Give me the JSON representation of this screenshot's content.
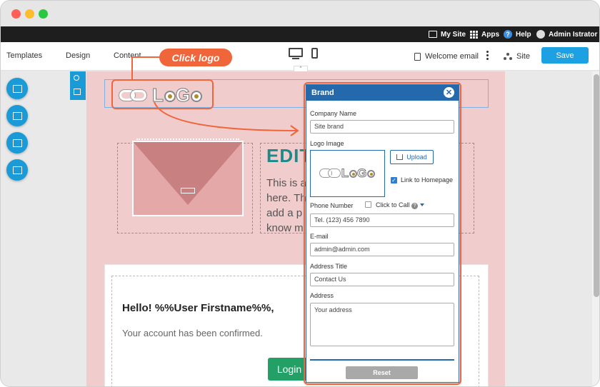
{
  "topbar": {
    "my_site": "My Site",
    "apps": "Apps",
    "help": "Help",
    "user": "Admin Istrator"
  },
  "toolbar": {
    "tabs": [
      "Templates",
      "Design",
      "Content"
    ],
    "welcome_email": "Welcome email",
    "site": "Site",
    "save_label": "Save"
  },
  "callout": {
    "text": "Click logo"
  },
  "canvas": {
    "logo_text": "LOGO",
    "edit_title": "EDIT",
    "body_lines": [
      "This is a",
      "here. Th",
      "add a p",
      "know m"
    ],
    "hello": "Hello! %%User Firstname%%,",
    "confirmed": "Your account has been confirmed.",
    "login_label": "Login"
  },
  "brand_panel": {
    "title": "Brand",
    "company_name_label": "Company Name",
    "company_name_value": "Site brand",
    "logo_image_label": "Logo Image",
    "upload_label": "Upload",
    "link_home_label": "Link to Homepage",
    "link_home_checked": true,
    "phone_label": "Phone Number",
    "click_to_call_label": "Click to Call",
    "phone_value": "Tel. (123) 456 7890",
    "email_label": "E-mail",
    "email_value": "admin@admin.com",
    "address_title_label": "Address Title",
    "address_title_value": "Contact Us",
    "address_label": "Address",
    "address_placeholder": "Your address",
    "reset_label": "Reset"
  },
  "colors": {
    "accent": "#1da1e2",
    "panel_header": "#2569ad",
    "callout": "#f0653a",
    "canvas_bg": "#f0cccc",
    "login_button": "#22a065",
    "edit_title": "#1a8a8a"
  },
  "icons": [
    "my-site-icon",
    "apps-grid-icon",
    "help-icon",
    "avatar",
    "desktop-icon",
    "mobile-icon",
    "document-icon",
    "more-icon",
    "site-icon",
    "search-icon",
    "mail-icon",
    "close-icon",
    "upload-icon",
    "link-icon"
  ]
}
